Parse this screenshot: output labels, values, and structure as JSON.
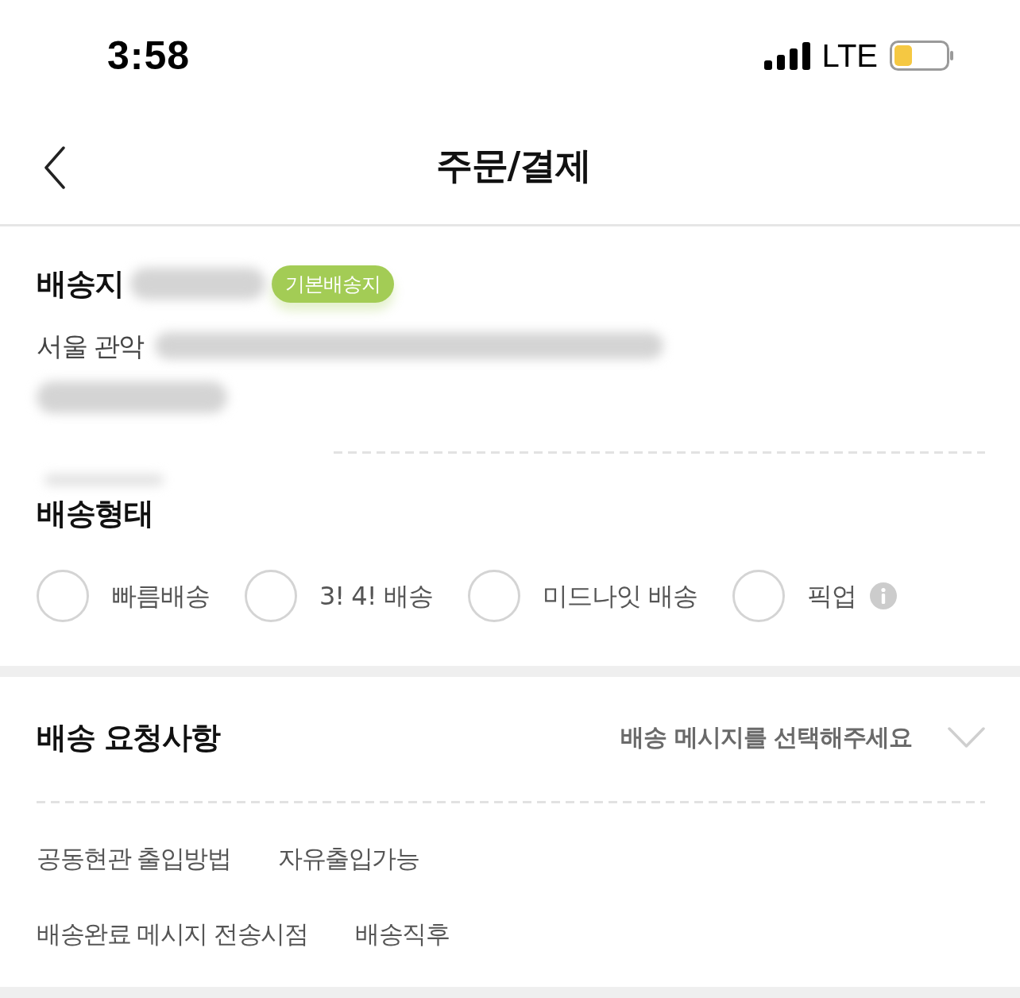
{
  "status_bar": {
    "time": "3:58",
    "network": "LTE"
  },
  "header": {
    "title": "주문/결제"
  },
  "shipping_address": {
    "title": "배송지",
    "badge": "기본배송지",
    "address": "서울 관악"
  },
  "delivery_type": {
    "title": "배송형태",
    "options": [
      {
        "label": "빠름배송",
        "selected": false,
        "info": false
      },
      {
        "label": "3! 4! 배송",
        "selected": false,
        "info": false
      },
      {
        "label": "미드나잇 배송",
        "selected": false,
        "info": false
      },
      {
        "label": "픽업",
        "selected": false,
        "info": true
      }
    ]
  },
  "delivery_request": {
    "title": "배송 요청사항",
    "message_select": {
      "placeholder": "배송 메시지를 선택해주세요"
    },
    "details": [
      {
        "label": "공동현관 출입방법",
        "value": "자유출입가능"
      },
      {
        "label": "배송완료 메시지 전송시점",
        "value": "배송직후"
      }
    ]
  }
}
